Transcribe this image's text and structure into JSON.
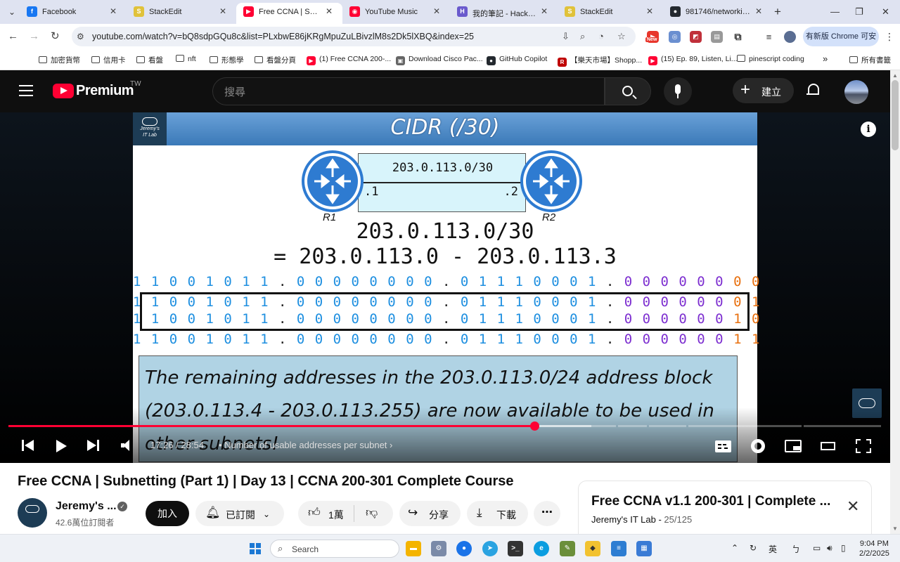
{
  "browser": {
    "tabs": [
      {
        "title": "Facebook",
        "icon": "facebook-icon",
        "color": "#1877f2",
        "letter": "f"
      },
      {
        "title": "StackEdit",
        "icon": "stackedit-icon",
        "color": "#e0c23a",
        "letter": "S"
      },
      {
        "title": "Free CCNA | Subnetti",
        "icon": "youtube-icon",
        "color": "#ff0033",
        "letter": "▶",
        "active": true
      },
      {
        "title": "YouTube Music",
        "icon": "youtube-music-icon",
        "color": "#ff0033",
        "letter": "◉"
      },
      {
        "title": "我的筆記 - HackMD",
        "icon": "hackmd-icon",
        "color": "#6a5acd",
        "letter": "H"
      },
      {
        "title": "StackEdit",
        "icon": "stackedit-icon",
        "color": "#e0c23a",
        "letter": "S"
      },
      {
        "title": "981746/networking-",
        "icon": "github-icon",
        "color": "#24292f",
        "letter": "●"
      }
    ],
    "url": "youtube.com/watch?v=bQ8sdpGQu8c&list=PLxbwE86jKRgMpuZuLBivzlM8s2Dk5lXBQ&index=25",
    "new_badge": "New",
    "update_button": "有新版 Chrome 可安裝",
    "bookmarks": [
      {
        "label": "加密貨幣",
        "type": "folder"
      },
      {
        "label": "信用卡",
        "type": "folder"
      },
      {
        "label": "看盤",
        "type": "folder"
      },
      {
        "label": "nft",
        "type": "folder"
      },
      {
        "label": "形態學",
        "type": "folder"
      },
      {
        "label": "看盤分頁",
        "type": "folder"
      },
      {
        "label": "(1) Free CCNA 200-...",
        "type": "youtube"
      },
      {
        "label": "Download Cisco Pac...",
        "type": "page"
      },
      {
        "label": "GitHub Copilot",
        "type": "github"
      },
      {
        "label": "【樂天市場】Shopp...",
        "type": "rakuten"
      },
      {
        "label": "(15) Ep. 89, Listen, Li...",
        "type": "youtube"
      },
      {
        "label": "pinescript coding",
        "type": "folder"
      }
    ],
    "bookmarks_overflow": "»",
    "all_bookmarks": "所有書籤"
  },
  "youtube": {
    "brand": "Premium",
    "region": "TW",
    "search_placeholder": "搜尋",
    "create_label": "建立"
  },
  "slide": {
    "title": "CIDR (/30)",
    "logo_line1": "Jeremy's",
    "logo_line2": "IT Lab",
    "link_prefix": "203.0.113.0/30",
    "r1_host": ".1",
    "r2_host": ".2",
    "r1_label": "R1",
    "r2_label": "R2",
    "cidr_line": "203.0.113.0/30",
    "range_line": "= 203.0.113.0 - 203.0.113.3",
    "binary_rows": [
      {
        "o1": "1 1 0 0 1 0 1 1",
        "o2": "0 0 0 0 0 0 0 0",
        "o3": "0 1 1 1 0 0 0 1",
        "o4a": "0 0 0 0 0 0",
        "o4b": "0 0"
      },
      {
        "o1": "1 1 0 0 1 0 1 1",
        "o2": "0 0 0 0 0 0 0 0",
        "o3": "0 1 1 1 0 0 0 1",
        "o4a": "0 0 0 0 0 0",
        "o4b": "0 1"
      },
      {
        "o1": "1 1 0 0 1 0 1 1",
        "o2": "0 0 0 0 0 0 0 0",
        "o3": "0 1 1 1 0 0 0 1",
        "o4a": "0 0 0 0 0 0",
        "o4b": "1 0"
      },
      {
        "o1": "1 1 0 0 1 0 1 1",
        "o2": "0 0 0 0 0 0 0 0",
        "o3": "0 1 1 1 0 0 0 1",
        "o4a": "0 0 0 0 0 0",
        "o4b": "1 1"
      }
    ],
    "note": "The remaining addresses in the 203.0.113.0/24 address block (203.0.113.4 - 203.0.113.255) are now available to be used in other subnets!"
  },
  "player": {
    "current_time": "17:26",
    "duration": "28:54",
    "chapter": "Number of usable addresses per subnet",
    "progress_fraction": 0.603,
    "buffered_fraction": 0.668
  },
  "video": {
    "title": "Free CCNA | Subnetting (Part 1) | Day 13 | CCNA 200-301 Complete Course",
    "channel_name": "Jeremy's ...",
    "subscribers": "42.6萬位訂閱者",
    "join_label": "加入",
    "subscribed_label": "已訂閱",
    "likes": "1萬",
    "share_label": "分享",
    "download_label": "下載"
  },
  "playlist": {
    "title": "Free CCNA v1.1 200-301 | Complete ...",
    "channel": "Jeremy's IT Lab",
    "position": "25/125"
  },
  "taskbar": {
    "search_label": "Search",
    "ime": "英",
    "time": "9:04 PM",
    "date": "2/2/2025"
  }
}
